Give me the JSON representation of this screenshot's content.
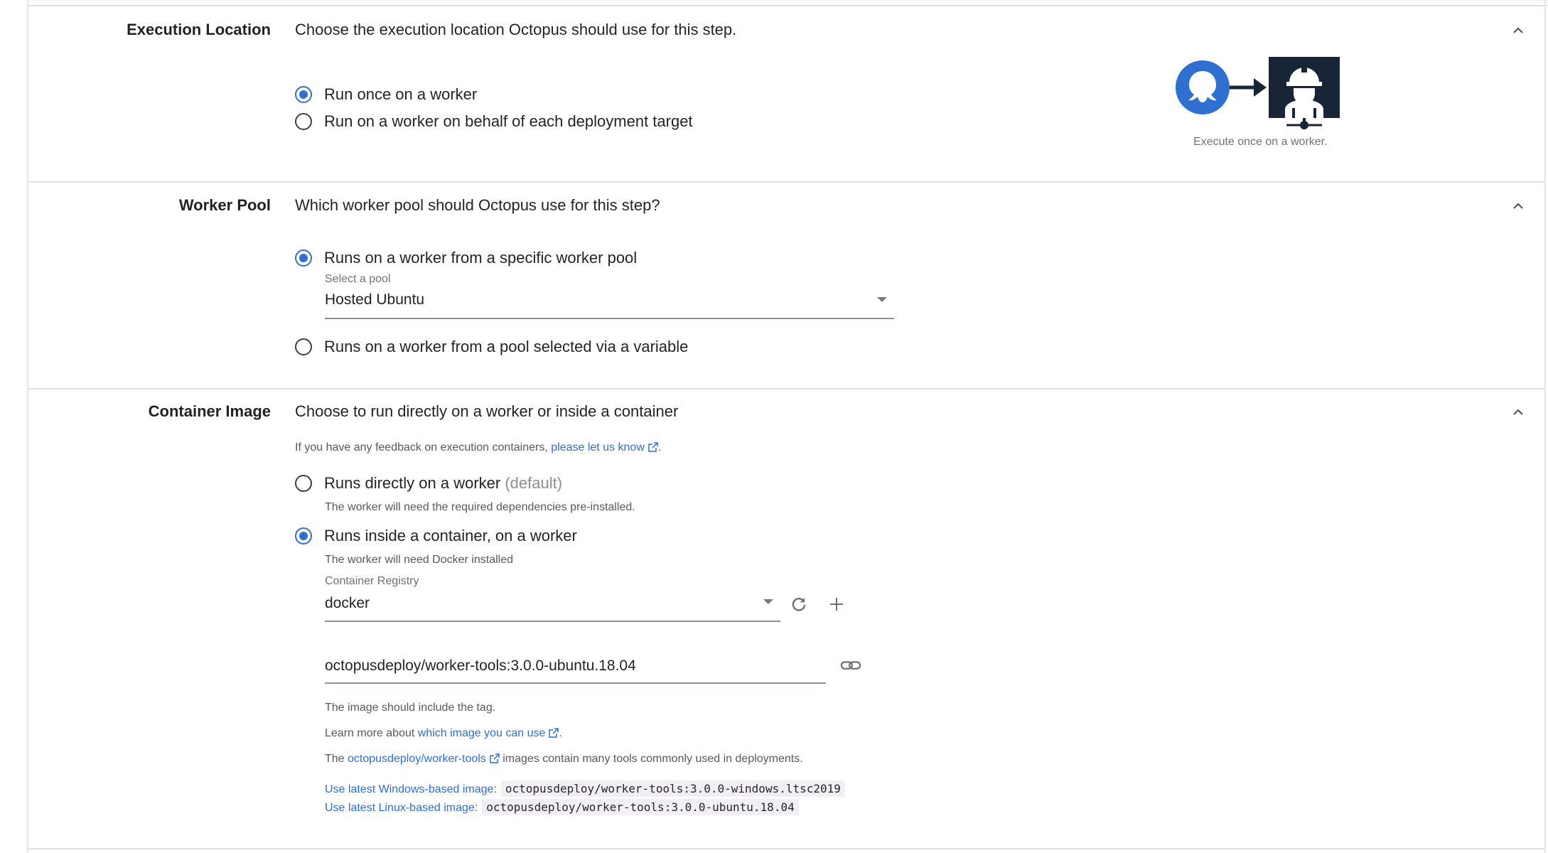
{
  "execution_location": {
    "label": "Execution Location",
    "description": "Choose the execution location Octopus should use for this step.",
    "options": [
      {
        "label": "Run once on a worker",
        "selected": true
      },
      {
        "label": "Run on a worker on behalf of each deployment target",
        "selected": false
      }
    ],
    "illustration_caption": "Execute once on a worker."
  },
  "worker_pool": {
    "label": "Worker Pool",
    "description": "Which worker pool should Octopus use for this step?",
    "option_specific": {
      "label": "Runs on a worker from a specific worker pool",
      "selected": true
    },
    "pool_field_label": "Select a pool",
    "pool_value": "Hosted Ubuntu",
    "option_variable": {
      "label": "Runs on a worker from a pool selected via a variable",
      "selected": false
    }
  },
  "container_image": {
    "label": "Container Image",
    "description": "Choose to run directly on a worker or inside a container",
    "feedback_prefix": "If you have any feedback on execution containers,",
    "feedback_link": "please let us know",
    "feedback_suffix": ".",
    "option_direct": {
      "label": "Runs directly on a worker",
      "suffix": "(default)",
      "hint": "The worker will need the required dependencies pre-installed.",
      "selected": false
    },
    "option_container": {
      "label": "Runs inside a container, on a worker",
      "hint": "The worker will need Docker installed",
      "selected": true
    },
    "registry_label": "Container Registry",
    "registry_value": "docker",
    "image_value": "octopusdeploy/worker-tools:3.0.0-ubuntu.18.04",
    "image_hint": "The image should include the tag.",
    "learn_prefix": "Learn more about",
    "learn_link": "which image you can use",
    "learn_suffix": ".",
    "tools_prefix": "The",
    "tools_link": "octopusdeploy/worker-tools",
    "tools_suffix": "images contain many tools commonly used in deployments.",
    "windows_link": "Use latest Windows-based image:",
    "windows_image": "octopusdeploy/worker-tools:3.0.0-windows.ltsc2019",
    "linux_link": "Use latest Linux-based image:",
    "linux_image": "octopusdeploy/worker-tools:3.0.0-ubuntu.18.04"
  },
  "colors": {
    "accent": "#2f6fd0",
    "illustration_dark": "#182536",
    "code_bg": "#f1eef4"
  }
}
